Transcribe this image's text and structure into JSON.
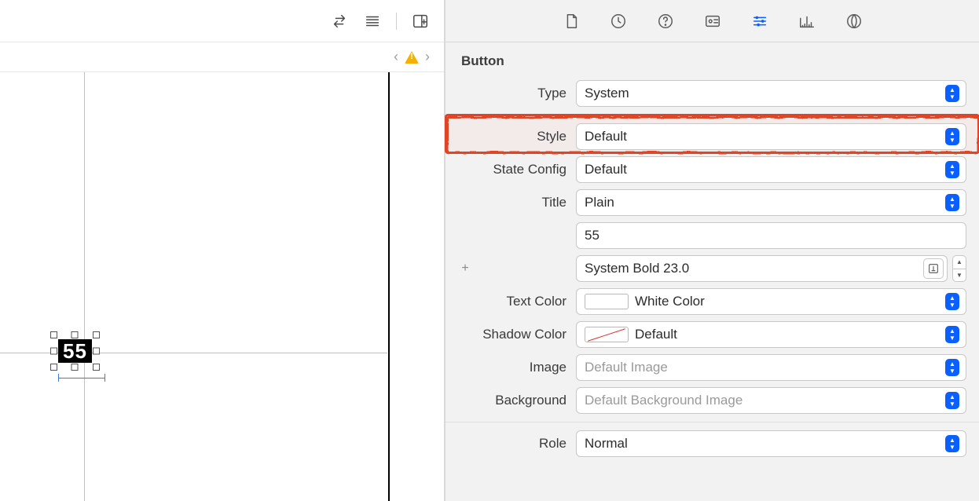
{
  "canvas": {
    "selected_button_text": "55"
  },
  "inspector": {
    "section": "Button",
    "type": {
      "label": "Type",
      "value": "System"
    },
    "style": {
      "label": "Style",
      "value": "Default"
    },
    "state_config": {
      "label": "State Config",
      "value": "Default"
    },
    "title": {
      "label": "Title",
      "value": "Plain"
    },
    "title_text": "55",
    "font": "System Bold 23.0",
    "text_color": {
      "label": "Text Color",
      "value": "White Color"
    },
    "shadow_color": {
      "label": "Shadow Color",
      "value": "Default"
    },
    "image": {
      "label": "Image",
      "placeholder": "Default Image"
    },
    "background": {
      "label": "Background",
      "placeholder": "Default Background Image"
    },
    "role": {
      "label": "Role",
      "value": "Normal"
    }
  }
}
